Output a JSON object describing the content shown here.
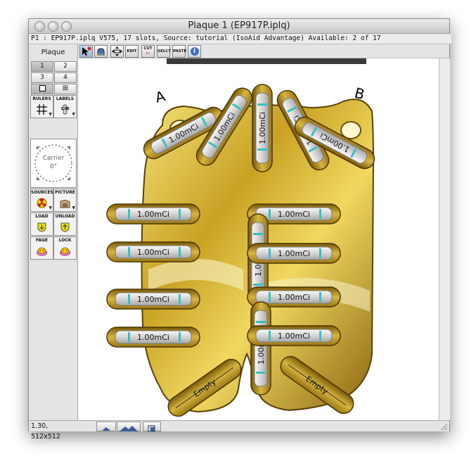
{
  "window": {
    "title": "Plaque 1 (EP917P.iplq)"
  },
  "infobar": {
    "text": "P1 : EP917P.iplq V575, 17 slots, Source: tutorial (IsoAid Advantage) Available: 2 of 17"
  },
  "sidebar": {
    "header": "Plaque",
    "numbers": [
      "1",
      "2",
      "3",
      "4"
    ],
    "tools": {
      "rulers": "RULERS",
      "labels": "LABELS",
      "labels_value": "1.00",
      "sources": "SOURCES",
      "picture": "PICTURE",
      "load": "LOAD",
      "unload": "UNLOAD",
      "fage": "FAGE",
      "lock": "LOCK"
    },
    "carrier": {
      "label": "Carrier",
      "angle": "0°"
    }
  },
  "toolbar": {
    "edit": "EDIT",
    "cut": "CUT",
    "select": "SELCT",
    "paste": "PASTE",
    "info": "i"
  },
  "plaque": {
    "corner_a": "A",
    "corner_b": "B",
    "seeds": [
      "1.00mCi",
      "1.00mCi",
      "1.00mCi",
      "1.00mCi",
      "1.00mCi",
      "1.00mCi",
      "1.00mCi",
      "1.00mCi",
      "1.00mCi",
      "1.00mCi",
      "1.00mCi",
      "1.00mCi",
      "1.00mCi",
      "1.00mCi",
      "1.00mCi"
    ],
    "empty_slots": [
      "Empty",
      "Empty"
    ]
  },
  "status": {
    "zoom": "1.30, 512x512"
  },
  "colors": {
    "gold_light": "#f2dc6a",
    "gold_dark": "#7a5a08",
    "seed_marker": "#3bbfbf"
  }
}
